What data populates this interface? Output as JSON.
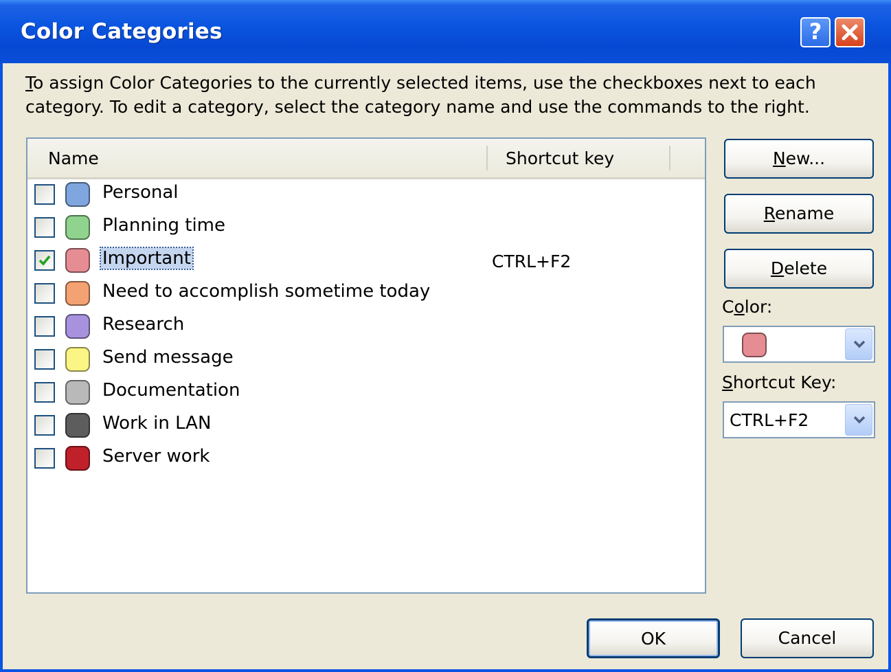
{
  "dialog": {
    "title": "Color Categories",
    "help_glyph": "?",
    "instructions_line1": "To assign Color Categories to the currently selected items, use the checkboxes next to each",
    "instructions_line2": "category.  To edit a category, select the category name and use the commands to the right."
  },
  "list": {
    "col_name": "Name",
    "col_shortcut": "Shortcut key",
    "rows": [
      {
        "name": "Personal",
        "color": "#7fa6de",
        "checked": false,
        "shortcut": "",
        "selected": false
      },
      {
        "name": "Planning time",
        "color": "#8fd38f",
        "checked": false,
        "shortcut": "",
        "selected": false
      },
      {
        "name": "Important",
        "color": "#e68d94",
        "checked": true,
        "shortcut": "CTRL+F2",
        "selected": true
      },
      {
        "name": "Need to accomplish sometime today",
        "color": "#f4a272",
        "checked": false,
        "shortcut": "",
        "selected": false
      },
      {
        "name": "Research",
        "color": "#a892dd",
        "checked": false,
        "shortcut": "",
        "selected": false
      },
      {
        "name": "Send message",
        "color": "#fbf585",
        "checked": false,
        "shortcut": "",
        "selected": false
      },
      {
        "name": "Documentation",
        "color": "#b9b9b9",
        "checked": false,
        "shortcut": "",
        "selected": false
      },
      {
        "name": "Work in LAN",
        "color": "#5d5d5d",
        "checked": false,
        "shortcut": "",
        "selected": false
      },
      {
        "name": "Server work",
        "color": "#c0202a",
        "checked": false,
        "shortcut": "",
        "selected": false
      }
    ]
  },
  "buttons": {
    "new_mnemonic": "N",
    "new_rest": "ew...",
    "rename_mnemonic": "R",
    "rename_rest": "ename",
    "delete_mnemonic": "D",
    "delete_rest": "elete",
    "ok": "OK",
    "cancel": "Cancel"
  },
  "color_field": {
    "label_pre": "C",
    "label_mnemonic": "o",
    "label_post": "lor:",
    "selected_color": "#e68d94"
  },
  "shortcut_field": {
    "label_mnemonic": "S",
    "label_rest": "hortcut Key:",
    "value": "CTRL+F2"
  },
  "colors": {
    "titlebar": "#0a55e0",
    "dialog_bg": "#ece9d8",
    "selection": "#c4d5ee",
    "checkmark": "#21a121"
  }
}
